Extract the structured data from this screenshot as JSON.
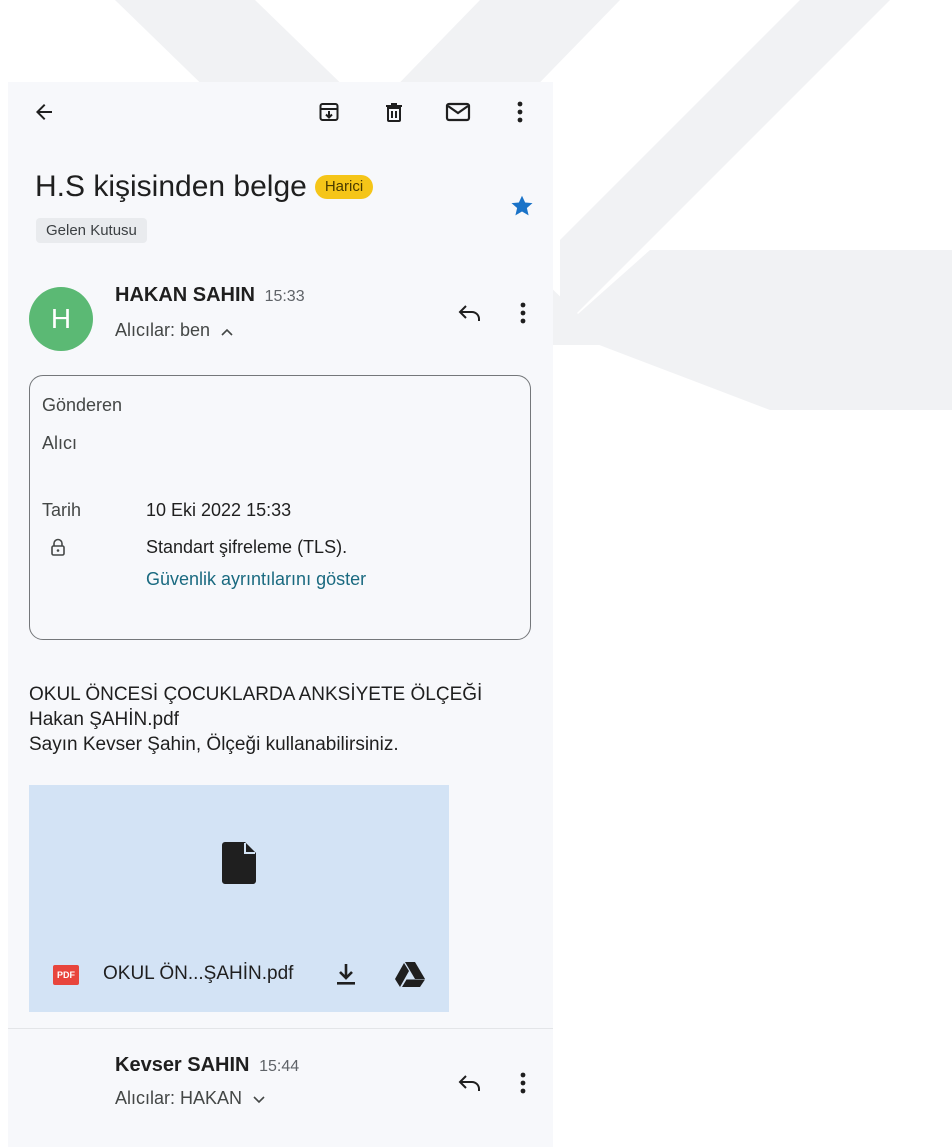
{
  "toolbar": {
    "back_icon": "arrow-left-icon",
    "archive_icon": "archive-icon",
    "delete_icon": "trash-icon",
    "unread_icon": "mail-icon",
    "more_icon": "more-vert-icon"
  },
  "subject": {
    "title": "H.S kişisinden belge",
    "badge": "Harici",
    "label_chip": "Gelen Kutusu",
    "star_color": "#1a73c8"
  },
  "message1": {
    "avatar_letter": "H",
    "avatar_color": "#5bb974",
    "sender": "HAKAN SAHIN",
    "time": "15:33",
    "recipients": "Alıcılar: ben",
    "details": {
      "from_label": "Gönderen",
      "to_label": "Alıcı",
      "date_label": "Tarih",
      "date_value": "10 Eki 2022 15:33",
      "encryption": "Standart şifreleme (TLS).",
      "security_link": "Güvenlik ayrıntılarını göster"
    },
    "body_line1": "OKUL ÖNCESİ ÇOCUKLARDA ANKSİYETE ÖLÇEĞİ",
    "body_line2": "Hakan ŞAHİN.pdf",
    "body_line3": "Sayın Kevser Şahin, Ölçeği kullanabilirsiniz.",
    "attachment": {
      "type_badge": "PDF",
      "filename": "OKUL ÖN...ŞAHİN.pdf"
    }
  },
  "message2": {
    "sender": "Kevser SAHIN",
    "time": "15:44",
    "recipients": "Alıcılar: HAKAN"
  },
  "colors": {
    "background": "#f7f8fb",
    "badge": "#f5c518",
    "attachment_bg": "#d3e3f5",
    "link": "#1a6a80"
  }
}
